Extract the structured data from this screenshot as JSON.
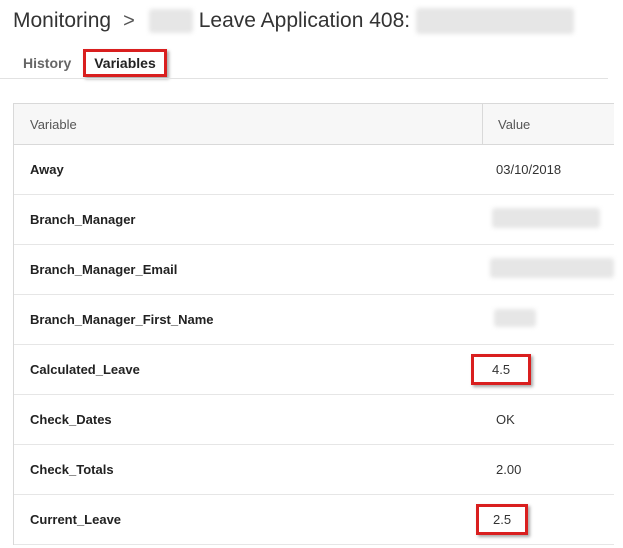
{
  "header": {
    "root": "Monitoring",
    "separator": ">",
    "title": "Leave Application 408:"
  },
  "tabs": [
    {
      "label": "History",
      "active": false
    },
    {
      "label": "Variables",
      "active": true
    }
  ],
  "table": {
    "columns": [
      "Variable",
      "Value"
    ],
    "rows": [
      {
        "variable": "Away",
        "value": "03/10/2018"
      },
      {
        "variable": "Branch_Manager",
        "value": ""
      },
      {
        "variable": "Branch_Manager_Email",
        "value": ""
      },
      {
        "variable": "Branch_Manager_First_Name",
        "value": ""
      },
      {
        "variable": "Calculated_Leave",
        "value": "4.5"
      },
      {
        "variable": "Check_Dates",
        "value": "OK"
      },
      {
        "variable": "Check_Totals",
        "value": "2.00"
      },
      {
        "variable": "Current_Leave",
        "value": "2.5"
      }
    ]
  },
  "colors": {
    "highlight": "#d91f1f"
  }
}
